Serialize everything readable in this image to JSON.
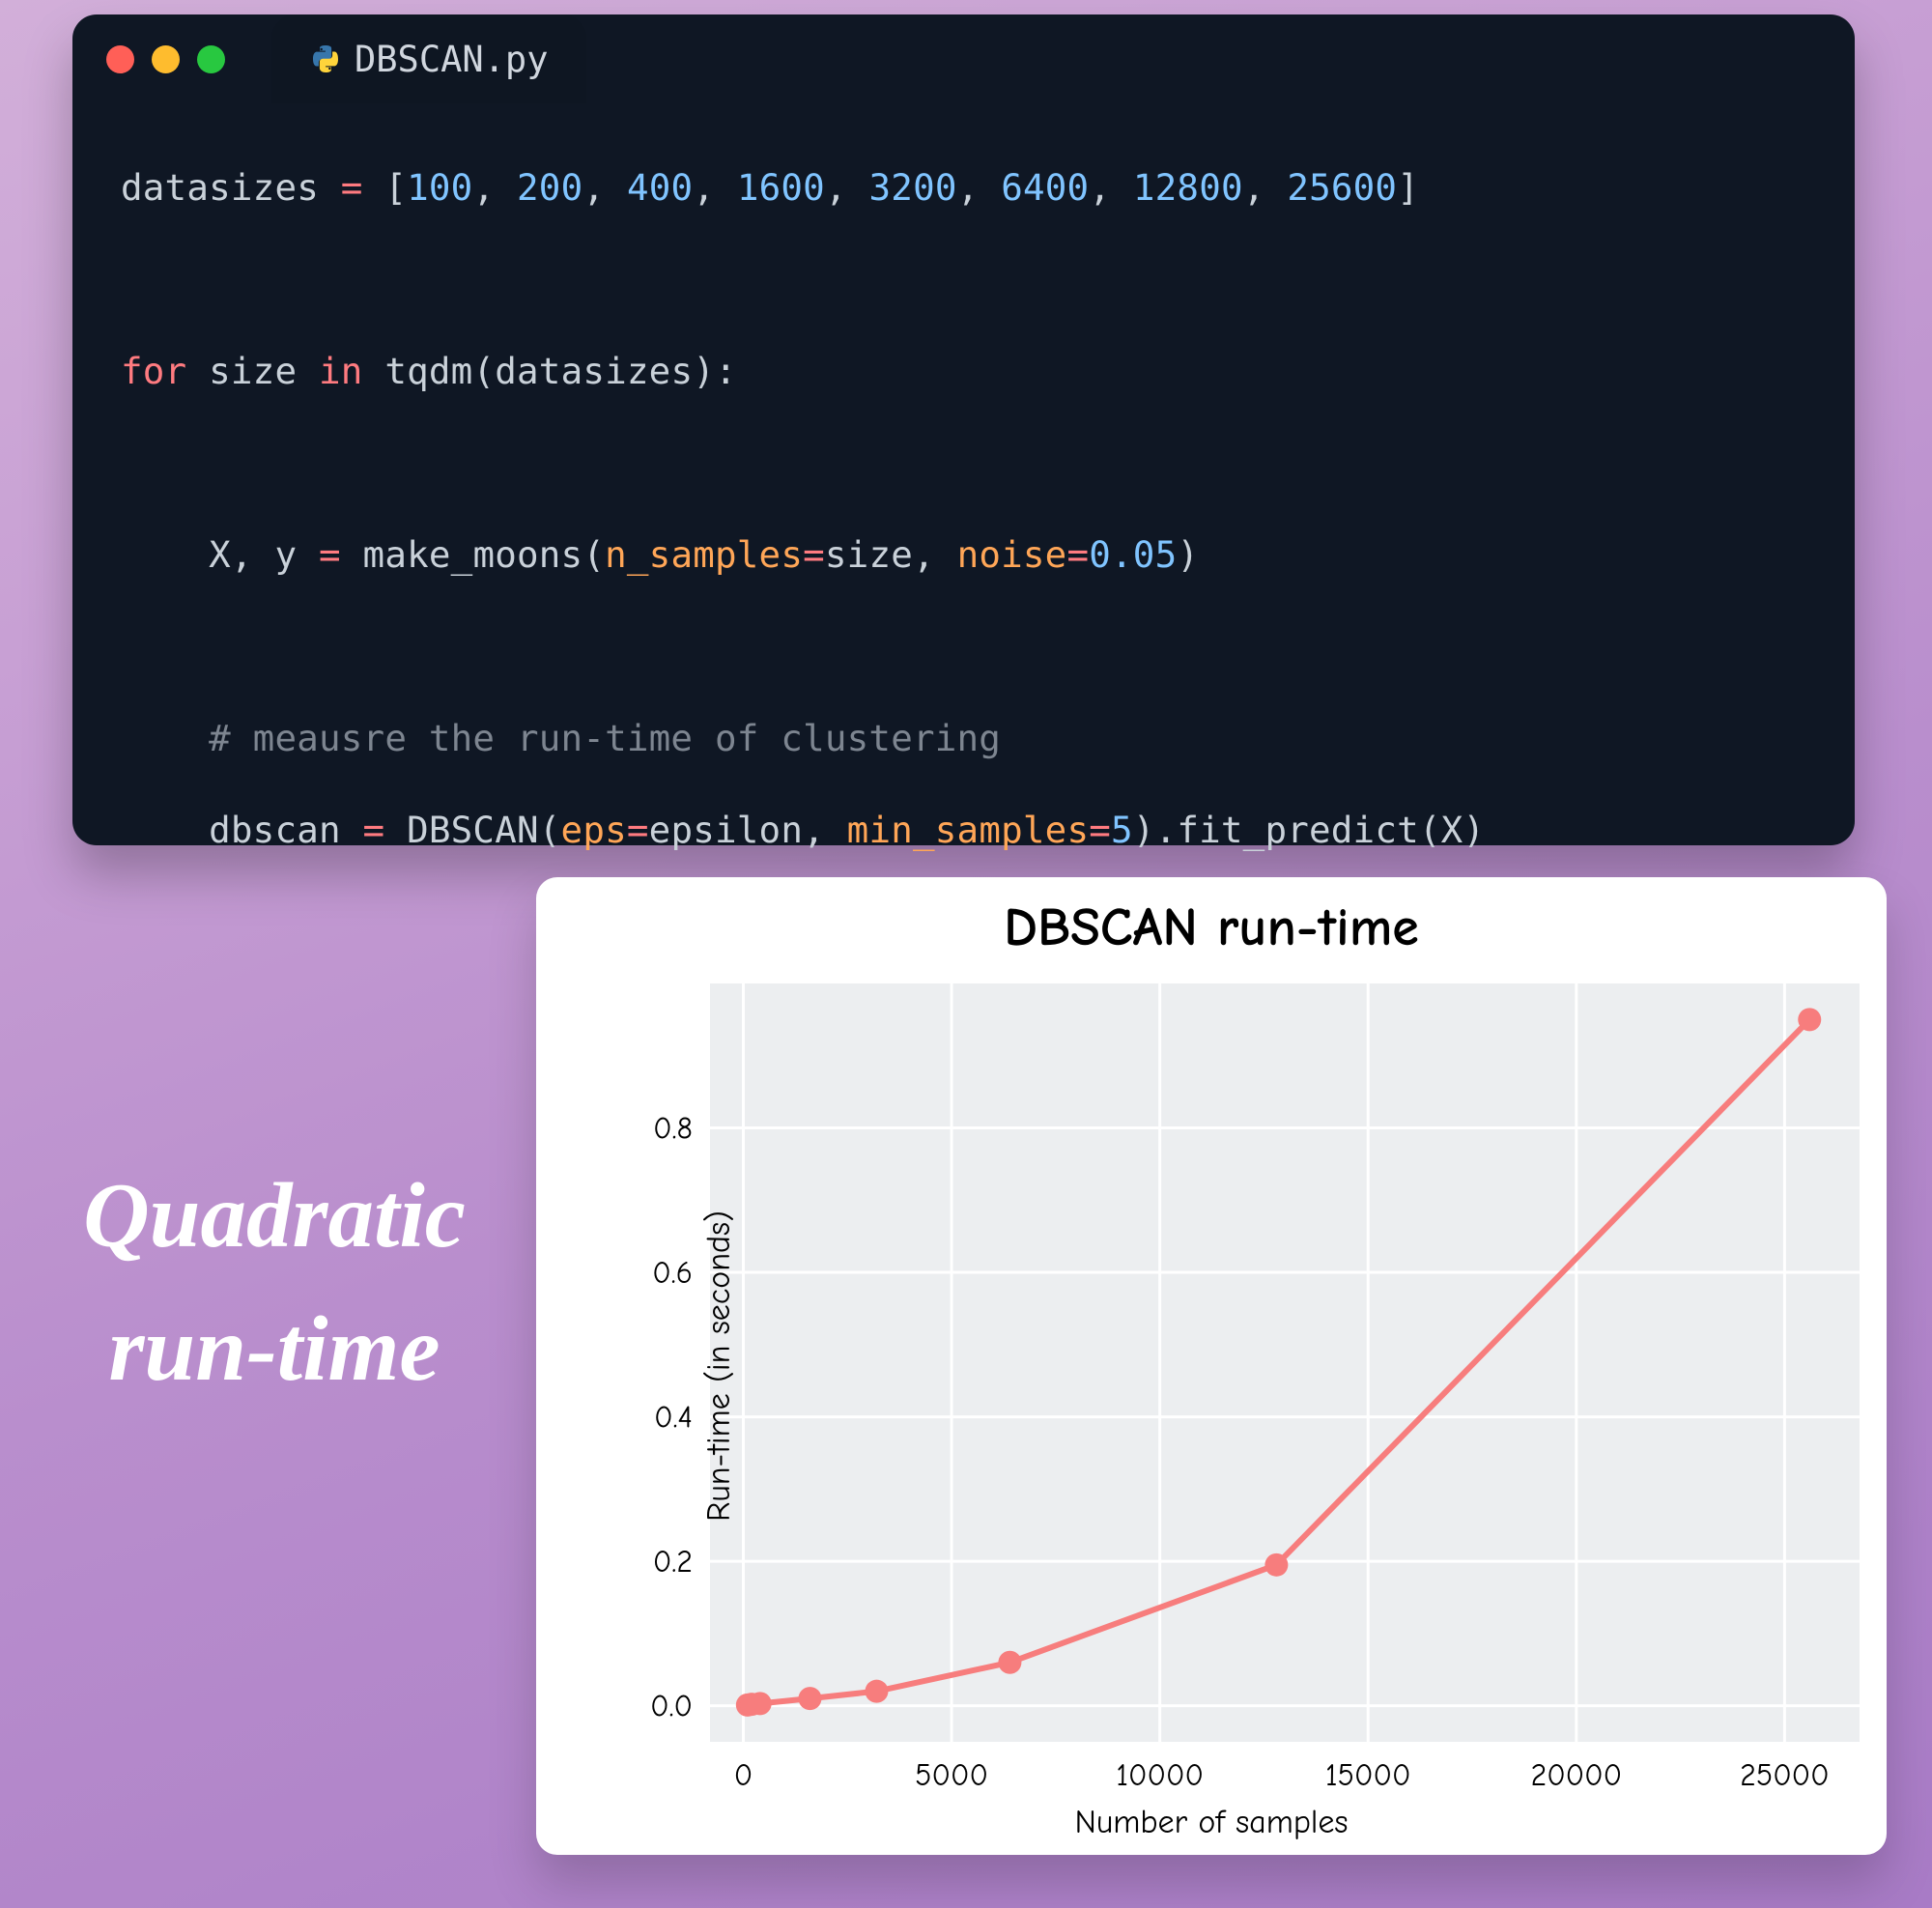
{
  "editor": {
    "filename": "DBSCAN.py",
    "code_tokens": [
      {
        "line": 0,
        "tok": [
          {
            "t": "datasizes ",
            "c": "c-default"
          },
          {
            "t": "=",
            "c": "c-kw"
          },
          {
            "t": " [",
            "c": "c-default"
          },
          {
            "t": "100",
            "c": "c-num"
          },
          {
            "t": ", ",
            "c": "c-default"
          },
          {
            "t": "200",
            "c": "c-num"
          },
          {
            "t": ", ",
            "c": "c-default"
          },
          {
            "t": "400",
            "c": "c-num"
          },
          {
            "t": ", ",
            "c": "c-default"
          },
          {
            "t": "1600",
            "c": "c-num"
          },
          {
            "t": ", ",
            "c": "c-default"
          },
          {
            "t": "3200",
            "c": "c-num"
          },
          {
            "t": ", ",
            "c": "c-default"
          },
          {
            "t": "6400",
            "c": "c-num"
          },
          {
            "t": ", ",
            "c": "c-default"
          },
          {
            "t": "12800",
            "c": "c-num"
          },
          {
            "t": ", ",
            "c": "c-default"
          },
          {
            "t": "25600",
            "c": "c-num"
          },
          {
            "t": "]",
            "c": "c-default"
          }
        ]
      },
      {
        "line": 1,
        "tok": []
      },
      {
        "line": 2,
        "tok": [
          {
            "t": "for",
            "c": "c-kw"
          },
          {
            "t": " size ",
            "c": "c-default"
          },
          {
            "t": "in",
            "c": "c-kw"
          },
          {
            "t": " tqdm(datasizes):",
            "c": "c-default"
          }
        ]
      },
      {
        "line": 3,
        "tok": []
      },
      {
        "line": 4,
        "tok": [
          {
            "t": "    X, y ",
            "c": "c-default"
          },
          {
            "t": "=",
            "c": "c-kw"
          },
          {
            "t": " make_moons(",
            "c": "c-default"
          },
          {
            "t": "n_samples",
            "c": "c-arg"
          },
          {
            "t": "=",
            "c": "c-kw"
          },
          {
            "t": "size, ",
            "c": "c-default"
          },
          {
            "t": "noise",
            "c": "c-arg"
          },
          {
            "t": "=",
            "c": "c-kw"
          },
          {
            "t": "0.05",
            "c": "c-num"
          },
          {
            "t": ")",
            "c": "c-default"
          }
        ]
      },
      {
        "line": 5,
        "tok": []
      },
      {
        "line": 6,
        "tok": [
          {
            "t": "    # meausre the run-time of clustering",
            "c": "c-cmt"
          }
        ]
      },
      {
        "line": 7,
        "tok": [
          {
            "t": "    dbscan ",
            "c": "c-default"
          },
          {
            "t": "=",
            "c": "c-kw"
          },
          {
            "t": " DBSCAN(",
            "c": "c-default"
          },
          {
            "t": "eps",
            "c": "c-arg"
          },
          {
            "t": "=",
            "c": "c-kw"
          },
          {
            "t": "epsilon, ",
            "c": "c-default"
          },
          {
            "t": "min_samples",
            "c": "c-arg"
          },
          {
            "t": "=",
            "c": "c-kw"
          },
          {
            "t": "5",
            "c": "c-num"
          },
          {
            "t": ").fit_predict(X)",
            "c": "c-default"
          }
        ]
      }
    ]
  },
  "caption": "Quadratic run-time",
  "chart_data": {
    "type": "line",
    "title": "DBSCAN run-time",
    "xlabel": "Number of samples",
    "ylabel": "Run-time (in seconds)",
    "x": [
      100,
      200,
      400,
      1600,
      3200,
      6400,
      12800,
      25600
    ],
    "y": [
      0.001,
      0.002,
      0.003,
      0.01,
      0.02,
      0.06,
      0.195,
      0.95
    ],
    "xlim": [
      -800,
      26800
    ],
    "ylim": [
      -0.05,
      1.0
    ],
    "xticks": [
      0,
      5000,
      10000,
      15000,
      20000,
      25000
    ],
    "yticks": [
      0.0,
      0.2,
      0.4,
      0.6,
      0.8
    ],
    "line_color": "#f77d7d",
    "marker_color": "#f77d7d",
    "grid_color": "#ffffff",
    "plot_bg": "#eceef0"
  }
}
